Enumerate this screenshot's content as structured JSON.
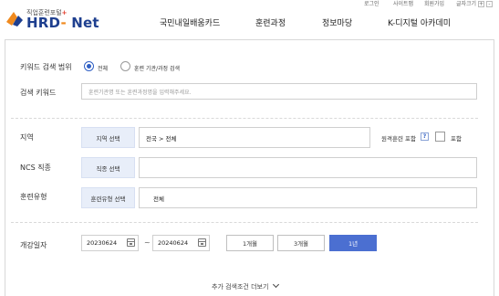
{
  "utility": {
    "login": "로그인",
    "sitemap": "사이트맵",
    "signup": "회원가입",
    "font_size_label": "글자크기",
    "font_plus": "+",
    "font_minus": "-"
  },
  "logo": {
    "small_text": "직업훈련포털",
    "main_text_a": "HRD",
    "main_text_dash": "-",
    "main_text_b": " Net"
  },
  "gnb": {
    "items": [
      "국민내일배움카드",
      "훈련과정",
      "정보마당",
      "K-디지털 아카데미"
    ]
  },
  "search": {
    "keyword_range_label": "키워드 검색 범위",
    "range_options": [
      "전체",
      "훈련 기관/과정 검색"
    ],
    "range_selected": 0,
    "keyword_label": "검색 키워드",
    "keyword_placeholder": "훈련기관명 또는 훈련과정명을 입력해주세요.",
    "region_label": "지역",
    "region_button": "지역 선택",
    "region_value": "전국 > 전체",
    "remote_label": "원격훈련 포함",
    "remote_help": "?",
    "remote_checkbox_label": "포함",
    "ncs_label": "NCS 직종",
    "ncs_button": "직종 선택",
    "ncs_value": "",
    "type_label": "훈련유형",
    "type_button": "훈련유형 선택",
    "type_value": "전체",
    "date_label": "개강일자",
    "date_start": "20230624",
    "date_end": "20240624",
    "date_separator": "~",
    "period_buttons": [
      "1개월",
      "3개월",
      "1년"
    ],
    "period_selected": 2,
    "more_label": "추가 검색조건 더보기"
  },
  "colors": {
    "accent": "#4b6fd1",
    "brand_navy": "#1e3f8f",
    "brand_orange": "#f08a1e",
    "tag_bg": "#e8eef9"
  }
}
